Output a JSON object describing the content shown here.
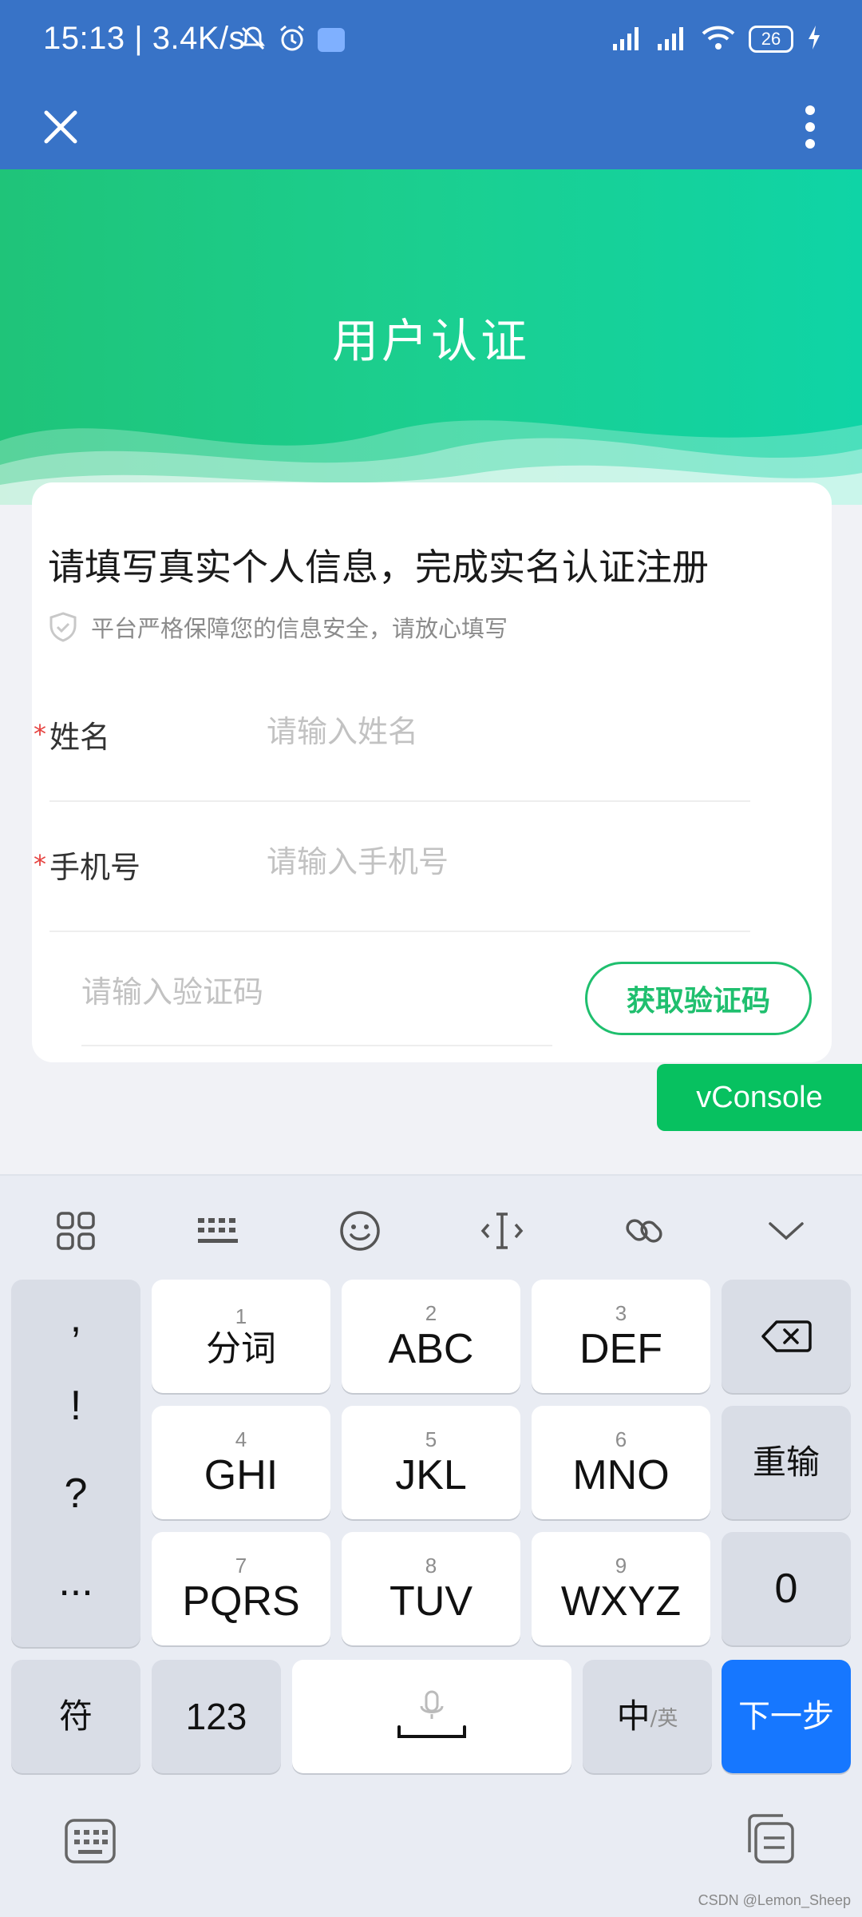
{
  "status_bar": {
    "time": "15:13 | 3.4K/s",
    "battery": "26"
  },
  "page": {
    "hero_title": "用户认证",
    "heading": "请填写真实个人信息，完成实名认证注册",
    "note": "平台严格保障您的信息安全，请放心填写"
  },
  "form": {
    "required_mark": "*",
    "name_label": "姓名",
    "name_placeholder": "请输入姓名",
    "phone_label": "手机号",
    "phone_placeholder": "请输入手机号",
    "code_placeholder": "请输入验证码",
    "get_code_button": "获取验证码"
  },
  "vconsole": "vConsole",
  "keyboard": {
    "punctuation": [
      ",",
      "!",
      "?",
      "..."
    ],
    "keys": [
      {
        "num": "1",
        "label": "分词"
      },
      {
        "num": "2",
        "label": "ABC"
      },
      {
        "num": "3",
        "label": "DEF"
      },
      {
        "num": "4",
        "label": "GHI"
      },
      {
        "num": "5",
        "label": "JKL"
      },
      {
        "num": "6",
        "label": "MNO"
      },
      {
        "num": "7",
        "label": "PQRS"
      },
      {
        "num": "8",
        "label": "TUV"
      },
      {
        "num": "9",
        "label": "WXYZ"
      }
    ],
    "reenter": "重输",
    "zero": "0",
    "symbol": "符",
    "numbers": "123",
    "lang_main": "中",
    "lang_sub": "/英",
    "next": "下一步"
  },
  "watermark": "CSDN @Lemon_Sheep",
  "colors": {
    "title_bar": "#3873c7",
    "accent_green": "#1fbf6e",
    "vconsole_green": "#07c160",
    "next_blue": "#1677ff",
    "required_red": "#e64340"
  }
}
